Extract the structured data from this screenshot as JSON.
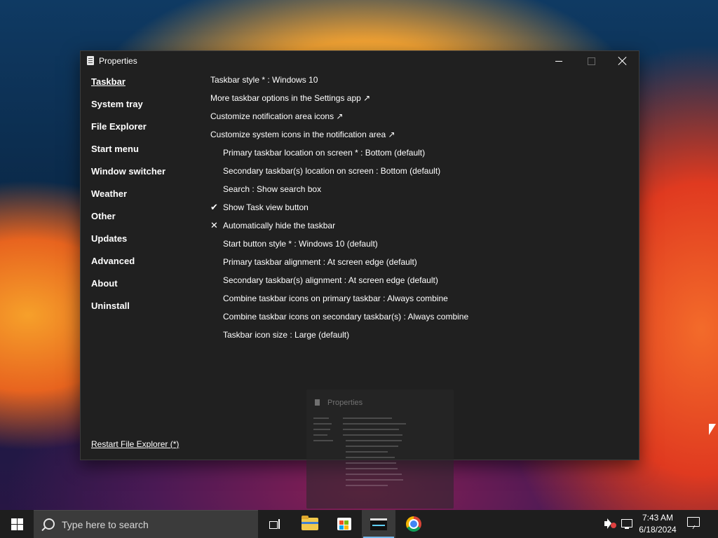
{
  "window": {
    "title": "Properties"
  },
  "sidebar": {
    "items": [
      {
        "label": "Taskbar",
        "active": true
      },
      {
        "label": "System tray"
      },
      {
        "label": "File Explorer"
      },
      {
        "label": "Start menu"
      },
      {
        "label": "Window switcher"
      },
      {
        "label": "Weather"
      },
      {
        "label": "Other"
      },
      {
        "label": "Updates"
      },
      {
        "label": "Advanced"
      },
      {
        "label": "About"
      },
      {
        "label": "Uninstall"
      }
    ],
    "restart_link": "Restart File Explorer (*)"
  },
  "settings": [
    {
      "text": "Taskbar style * : Windows 10",
      "indent": false,
      "mark": ""
    },
    {
      "text": "More taskbar options in the Settings app ↗",
      "indent": false,
      "mark": ""
    },
    {
      "text": "Customize notification area icons ↗",
      "indent": false,
      "mark": ""
    },
    {
      "text": "Customize system icons in the notification area ↗",
      "indent": false,
      "mark": ""
    },
    {
      "text": "Primary taskbar location on screen * : Bottom (default)",
      "indent": true,
      "mark": ""
    },
    {
      "text": "Secondary taskbar(s) location on screen : Bottom (default)",
      "indent": true,
      "mark": ""
    },
    {
      "text": "Search : Show search box",
      "indent": true,
      "mark": ""
    },
    {
      "text": "Show Task view button",
      "indent": true,
      "mark": "✔"
    },
    {
      "text": "Automatically hide the taskbar",
      "indent": true,
      "mark": "✕"
    },
    {
      "text": "Start button style * : Windows 10 (default)",
      "indent": true,
      "mark": ""
    },
    {
      "text": "Primary taskbar alignment : At screen edge (default)",
      "indent": true,
      "mark": ""
    },
    {
      "text": "Secondary taskbar(s) alignment : At screen edge (default)",
      "indent": true,
      "mark": ""
    },
    {
      "text": "Combine taskbar icons on primary taskbar : Always combine",
      "indent": true,
      "mark": ""
    },
    {
      "text": "Combine taskbar icons on secondary taskbar(s) : Always combine",
      "indent": true,
      "mark": ""
    },
    {
      "text": "Taskbar icon size : Large (default)",
      "indent": true,
      "mark": ""
    }
  ],
  "ghost_preview": {
    "title": "Properties"
  },
  "taskbar": {
    "search_placeholder": "Type here to search",
    "time": "7:43 AM",
    "date": "6/18/2024",
    "pinned": [
      "task-view",
      "file-explorer",
      "microsoft-store",
      "terminal",
      "chrome"
    ]
  }
}
